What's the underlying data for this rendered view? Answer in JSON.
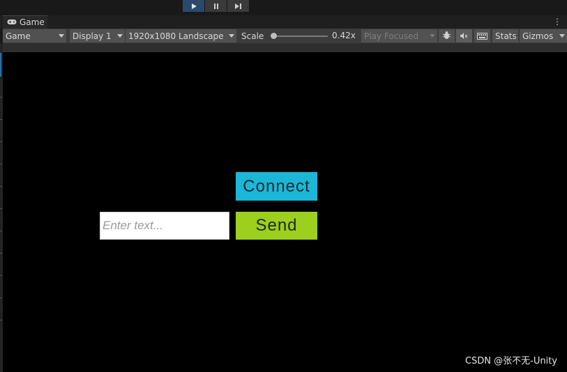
{
  "window": {
    "tab_label": "Game",
    "tab_icon": "gamepad-icon"
  },
  "controls": {
    "play_icon": "play-icon",
    "pause_icon": "pause-icon",
    "step_icon": "step-icon",
    "play_active": true
  },
  "toolbar": {
    "view_mode": "Game",
    "display": "Display 1",
    "resolution": "1920x1080 Landscape",
    "scale_label": "Scale",
    "scale_value": "0.42x",
    "scale_fraction": 0.02,
    "play_mode": "Play Focused",
    "stats_label": "Stats",
    "gizmos_label": "Gizmos",
    "bug_icon": "bug-icon",
    "mute_icon": "audio-mute-icon",
    "keyboard_icon": "keyboard-icon"
  },
  "game": {
    "connect_label": "Connect",
    "send_label": "Send",
    "input_placeholder": "Enter text...",
    "input_value": "",
    "connect_color": "#1cb7d6",
    "send_color": "#9ccf1e"
  },
  "watermark": "CSDN @张不无-Unity"
}
